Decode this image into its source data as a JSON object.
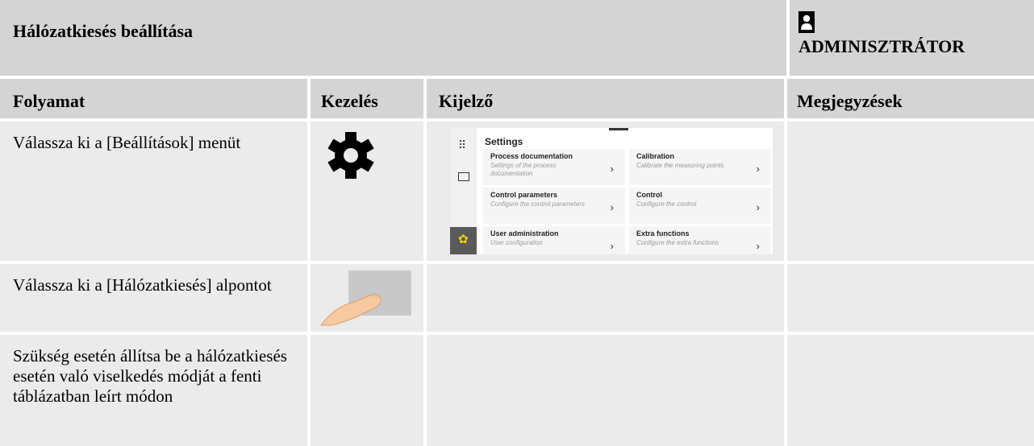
{
  "header": {
    "title": "Hálózatkiesés beállítása",
    "role": "ADMINISZTRÁTOR"
  },
  "columns": {
    "process": "Folyamat",
    "operation": "Kezelés",
    "display": "Kijelző",
    "notes": "Megjegyzések"
  },
  "rows": [
    {
      "process": "Válassza ki a [Beállítások] menüt",
      "operation_icon": "gear-icon",
      "notes": ""
    },
    {
      "process": "Válassza ki a [Hálózatkiesés] alpontot",
      "operation_icon": "finger-tap-icon",
      "notes": ""
    },
    {
      "process": "Szükség esetén állítsa be a hálózatkiesés esetén való viselkedés módját a fenti táblázatban leírt módon",
      "notes": ""
    }
  ],
  "settings_screen": {
    "title": "Settings",
    "tiles": [
      {
        "title": "Process documentation",
        "subtitle": "Settings of the process documentation"
      },
      {
        "title": "Calibration",
        "subtitle": "Calibrate the measuring points"
      },
      {
        "title": "Control parameters",
        "subtitle": "Configure the control parameters"
      },
      {
        "title": "Control",
        "subtitle": "Configure the control"
      },
      {
        "title": "User administration",
        "subtitle": "User configuration"
      },
      {
        "title": "Extra functions",
        "subtitle": "Configure the extra functions"
      }
    ],
    "chevron": "›",
    "accent_color": "#f2d600"
  }
}
